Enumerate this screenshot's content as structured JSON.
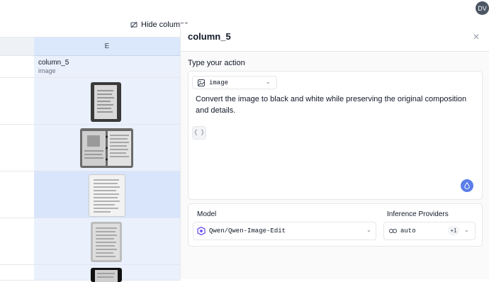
{
  "toolbar": {
    "hide_columns_label": "Hide columns"
  },
  "user": {
    "avatar_initials": "DV"
  },
  "grid": {
    "column_letter": "E",
    "column_name": "column_5",
    "column_type": "image",
    "rows": [
      {
        "image": "notebook page, handwritten"
      },
      {
        "image": "open ring binder with notes"
      },
      {
        "image": "handwritten letter page"
      },
      {
        "image": "lined page with handwriting"
      },
      {
        "image": "handwritten page on dark background"
      }
    ]
  },
  "panel": {
    "title": "column_5",
    "action_label": "Type your action",
    "type_value": "image",
    "prompt": "Convert the image to black and white while preserving the original composition and details.",
    "braces": "{ }",
    "model_label": "Model",
    "model_value": "Qwen/Qwen-Image-Edit",
    "providers_label": "Inference Providers",
    "provider_value": "auto",
    "provider_extra": "+1"
  },
  "colors": {
    "accent": "#5b7de9",
    "selected_column": "#dbe7fb"
  }
}
